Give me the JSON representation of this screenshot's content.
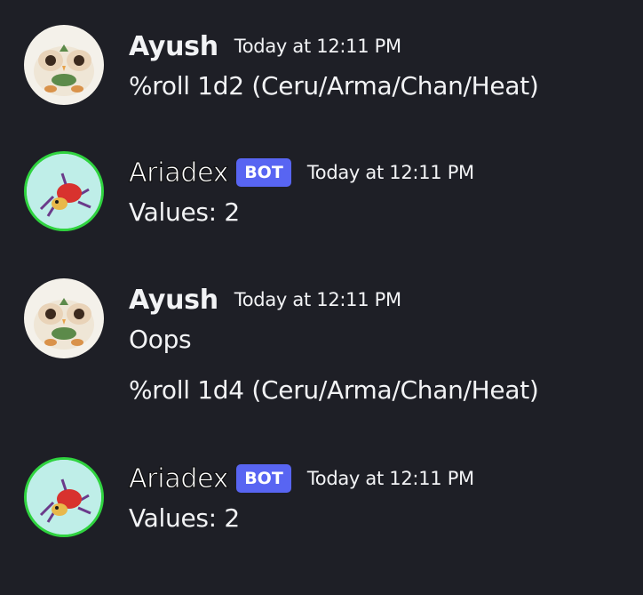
{
  "messages": [
    {
      "author": "Ayush",
      "is_bot": false,
      "avatar_icon": "rowlet-avatar-icon",
      "timestamp": "Today at 12:11 PM",
      "lines": [
        "%roll 1d2 (Ceru/Arma/Chan/Heat)"
      ]
    },
    {
      "author": "Ariadex",
      "is_bot": true,
      "bot_tag": "BOT",
      "avatar_icon": "ariados-avatar-icon",
      "timestamp": "Today at 12:11 PM",
      "lines": [
        "Values: 2"
      ]
    },
    {
      "author": "Ayush",
      "is_bot": false,
      "avatar_icon": "rowlet-avatar-icon",
      "timestamp": "Today at 12:11 PM",
      "lines": [
        "Oops",
        "%roll 1d4 (Ceru/Arma/Chan/Heat)"
      ]
    },
    {
      "author": "Ariadex",
      "is_bot": true,
      "bot_tag": "BOT",
      "avatar_icon": "ariados-avatar-icon",
      "timestamp": "Today at 12:11 PM",
      "lines": [
        "Values: 2"
      ]
    }
  ],
  "colors": {
    "background": "#1e1f26",
    "text": "#f2f3f5",
    "bot_tag": "#5865f2",
    "bot_avatar_ring": "#2fd33f",
    "bot_avatar_bg": "#bfeee8"
  }
}
